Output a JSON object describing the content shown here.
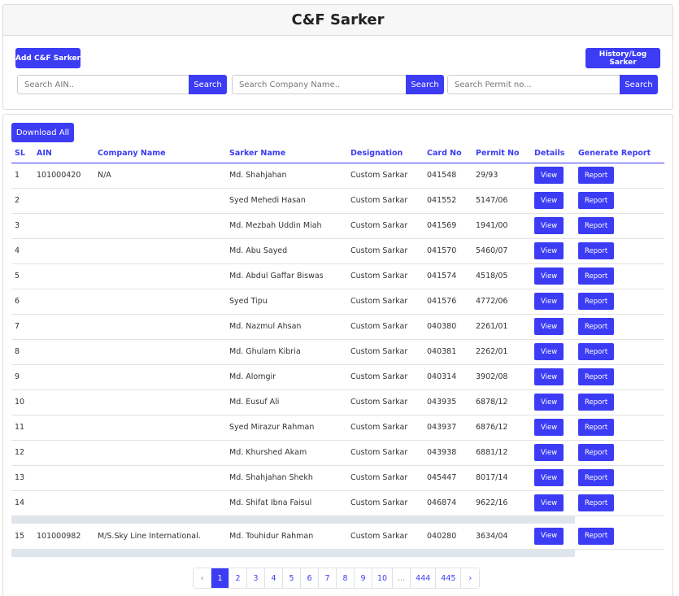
{
  "header": {
    "title": "C&F Sarker"
  },
  "toolbar": {
    "add_label": "Add C&F Sarker",
    "history_label": "History/Log Sarker",
    "download_label": "Download All"
  },
  "search": {
    "ain_placeholder": "Search AIN..",
    "company_placeholder": "Search Company Name..",
    "permit_placeholder": "Search Permit no...",
    "button_label": "Search"
  },
  "table": {
    "headers": [
      "SL",
      "AIN",
      "Company Name",
      "Sarker Name",
      "Designation",
      "Card No",
      "Permit No",
      "Details",
      "Generate Report"
    ],
    "view_label": "View",
    "report_label": "Report",
    "rows": [
      {
        "sl": "1",
        "ain": "101000420",
        "company": "N/A",
        "name": "Md. Shahjahan",
        "designation": "Custom Sarkar",
        "card": "041548",
        "permit": "29/93"
      },
      {
        "sl": "2",
        "ain": "",
        "company": "",
        "name": "Syed Mehedi Hasan",
        "designation": "Custom Sarkar",
        "card": "041552",
        "permit": "5147/06"
      },
      {
        "sl": "3",
        "ain": "",
        "company": "",
        "name": "Md. Mezbah Uddin Miah",
        "designation": "Custom Sarkar",
        "card": "041569",
        "permit": "1941/00"
      },
      {
        "sl": "4",
        "ain": "",
        "company": "",
        "name": "Md. Abu Sayed",
        "designation": "Custom Sarkar",
        "card": "041570",
        "permit": "5460/07"
      },
      {
        "sl": "5",
        "ain": "",
        "company": "",
        "name": "Md. Abdul Gaffar Biswas",
        "designation": "Custom Sarkar",
        "card": "041574",
        "permit": "4518/05"
      },
      {
        "sl": "6",
        "ain": "",
        "company": "",
        "name": "Syed Tipu",
        "designation": "Custom Sarkar",
        "card": "041576",
        "permit": "4772/06"
      },
      {
        "sl": "7",
        "ain": "",
        "company": "",
        "name": "Md. Nazmul Ahsan",
        "designation": "Custom Sarkar",
        "card": "040380",
        "permit": "2261/01"
      },
      {
        "sl": "8",
        "ain": "",
        "company": "",
        "name": "Md. Ghulam Kibria",
        "designation": "Custom Sarkar",
        "card": "040381",
        "permit": "2262/01"
      },
      {
        "sl": "9",
        "ain": "",
        "company": "",
        "name": "Md. Alomgir",
        "designation": "Custom Sarkar",
        "card": "040314",
        "permit": "3902/08"
      },
      {
        "sl": "10",
        "ain": "",
        "company": "",
        "name": "Md. Eusuf Ali",
        "designation": "Custom Sarkar",
        "card": "043935",
        "permit": "6878/12"
      },
      {
        "sl": "11",
        "ain": "",
        "company": "",
        "name": "Syed Mirazur Rahman",
        "designation": "Custom Sarkar",
        "card": "043937",
        "permit": "6876/12"
      },
      {
        "sl": "12",
        "ain": "",
        "company": "",
        "name": "Md. Khurshed Akam",
        "designation": "Custom Sarkar",
        "card": "043938",
        "permit": "6881/12"
      },
      {
        "sl": "13",
        "ain": "",
        "company": "",
        "name": "Md. Shahjahan Shekh",
        "designation": "Custom Sarkar",
        "card": "045447",
        "permit": "8017/14"
      },
      {
        "sl": "14",
        "ain": "",
        "company": "",
        "name": "Md. Shifat Ibna Faisul",
        "designation": "Custom Sarkar",
        "card": "046874",
        "permit": "9622/16"
      }
    ],
    "group2_rows": [
      {
        "sl": "15",
        "ain": "101000982",
        "company": "M/S.Sky Line International.",
        "name": "Md. Touhidur Rahman",
        "designation": "Custom Sarkar",
        "card": "040280",
        "permit": "3634/04"
      }
    ]
  },
  "pagination": {
    "prev": "‹",
    "next": "›",
    "pages": [
      "1",
      "2",
      "3",
      "4",
      "5",
      "6",
      "7",
      "8",
      "9",
      "10",
      "...",
      "444",
      "445"
    ],
    "active": "1"
  },
  "colors": {
    "accent": "#3c3cf5",
    "spacer": "#dfe5ec"
  }
}
